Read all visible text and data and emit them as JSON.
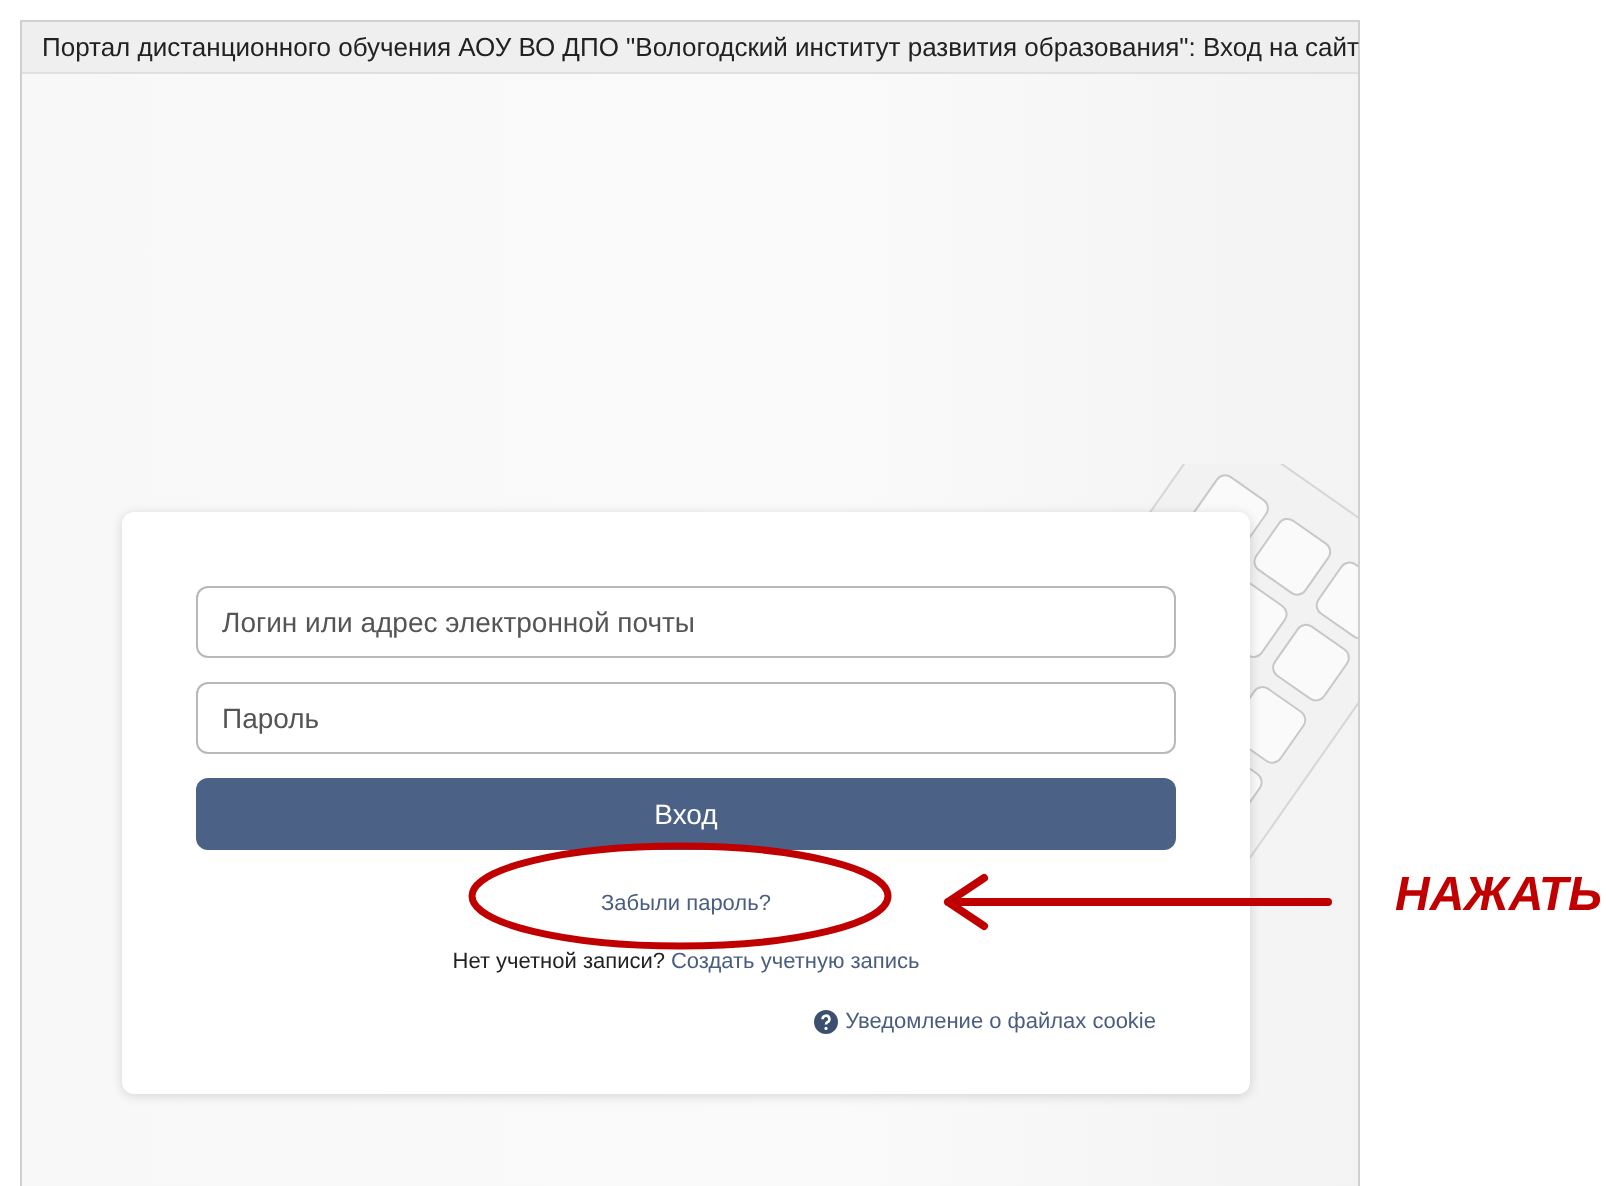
{
  "window": {
    "title": "Портал дистанционного обучения АОУ ВО ДПО \"Вологодский институт развития образования\": Вход на сайт"
  },
  "login_form": {
    "username": {
      "placeholder": "Логин или адрес электронной почты"
    },
    "password": {
      "placeholder": "Пароль"
    },
    "submit_button": "Вход",
    "forgot_password_link": "Забыли пароль?",
    "signup_prompt": "Нет учетной записи?",
    "signup_link": "Создать учетную запись",
    "cookie_notice_link": "Уведомление о файлах cookie"
  },
  "annotation": {
    "label": "НАЖАТЬ"
  }
}
